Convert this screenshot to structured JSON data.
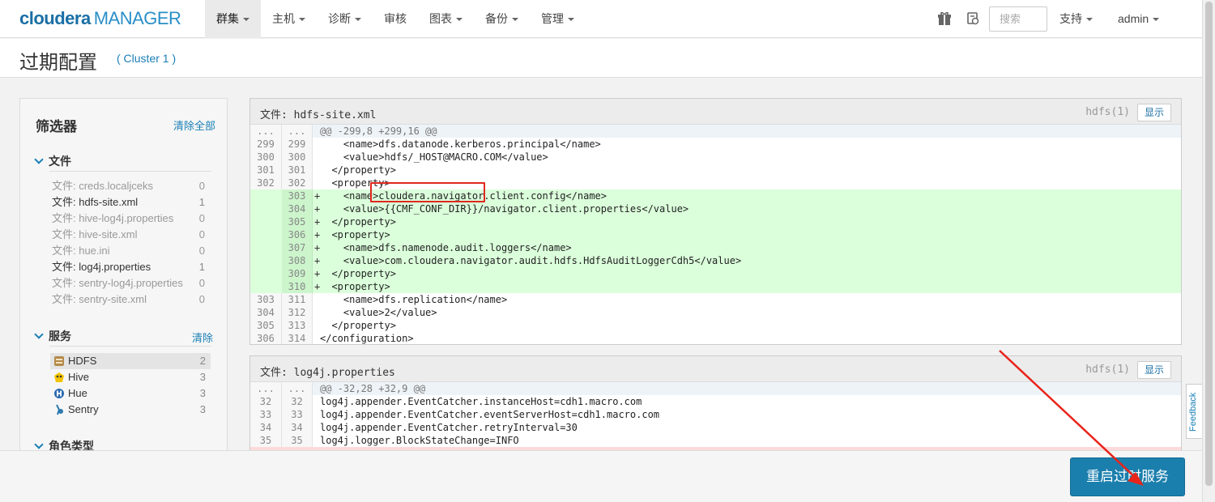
{
  "brand": {
    "name_bold": "cloudera",
    "name_rest": "MANAGER"
  },
  "nav": {
    "items": [
      {
        "label": "群集",
        "caret": true,
        "active": true
      },
      {
        "label": "主机",
        "caret": true
      },
      {
        "label": "诊断",
        "caret": true
      },
      {
        "label": "审核",
        "caret": false
      },
      {
        "label": "图表",
        "caret": true
      },
      {
        "label": "备份",
        "caret": true
      },
      {
        "label": "管理",
        "caret": true
      }
    ],
    "search_placeholder": "搜索",
    "support_label": "支持",
    "user_label": "admin"
  },
  "page": {
    "title": "过期配置",
    "cluster_link": "( Cluster 1 )"
  },
  "filters": {
    "title": "筛选器",
    "clear_all": "清除全部",
    "files_title": "文件",
    "files": [
      {
        "label": "文件: creds.localjceks",
        "count": "0",
        "active": false
      },
      {
        "label": "文件: hdfs-site.xml",
        "count": "1",
        "active": true
      },
      {
        "label": "文件: hive-log4j.properties",
        "count": "0",
        "active": false
      },
      {
        "label": "文件: hive-site.xml",
        "count": "0",
        "active": false
      },
      {
        "label": "文件: hue.ini",
        "count": "0",
        "active": false
      },
      {
        "label": "文件: log4j.properties",
        "count": "1",
        "active": true
      },
      {
        "label": "文件: sentry-log4j.properties",
        "count": "0",
        "active": false
      },
      {
        "label": "文件: sentry-site.xml",
        "count": "0",
        "active": false
      }
    ],
    "services_title": "服务",
    "services_clear": "清除",
    "services": [
      {
        "label": "HDFS",
        "count": "2",
        "icon": "hdfs-icon",
        "selected": true
      },
      {
        "label": "Hive",
        "count": "3",
        "icon": "hive-icon",
        "selected": false
      },
      {
        "label": "Hue",
        "count": "3",
        "icon": "hue-icon",
        "selected": false
      },
      {
        "label": "Sentry",
        "count": "3",
        "icon": "sentry-icon",
        "selected": false
      }
    ],
    "roles_title": "角色类型"
  },
  "panels": [
    {
      "file": "文件: hdfs-site.xml",
      "service": "hdfs(1)",
      "show": "显示",
      "rows": [
        {
          "type": "hunk",
          "n1": "...",
          "n2": "...",
          "mark": "",
          "text": "@@ -299,8 +299,16 @@"
        },
        {
          "type": "ctx",
          "n1": "299",
          "n2": "299",
          "mark": "",
          "text": "    <name>dfs.datanode.kerberos.principal</name>"
        },
        {
          "type": "ctx",
          "n1": "300",
          "n2": "300",
          "mark": "",
          "text": "    <value>hdfs/_HOST@MACRO.COM</value>"
        },
        {
          "type": "ctx",
          "n1": "301",
          "n2": "301",
          "mark": "",
          "text": "  </property>"
        },
        {
          "type": "ctx",
          "n1": "302",
          "n2": "302",
          "mark": "",
          "text": "  <property>"
        },
        {
          "type": "add",
          "n1": "",
          "n2": "303",
          "mark": "+",
          "text": "    <name>cloudera.navigator.client.config</name>"
        },
        {
          "type": "add",
          "n1": "",
          "n2": "304",
          "mark": "+",
          "text": "    <value>{{CMF_CONF_DIR}}/navigator.client.properties</value>"
        },
        {
          "type": "add",
          "n1": "",
          "n2": "305",
          "mark": "+",
          "text": "  </property>"
        },
        {
          "type": "add",
          "n1": "",
          "n2": "306",
          "mark": "+",
          "text": "  <property>"
        },
        {
          "type": "add",
          "n1": "",
          "n2": "307",
          "mark": "+",
          "text": "    <name>dfs.namenode.audit.loggers</name>"
        },
        {
          "type": "add",
          "n1": "",
          "n2": "308",
          "mark": "+",
          "text": "    <value>com.cloudera.navigator.audit.hdfs.HdfsAuditLoggerCdh5</value>"
        },
        {
          "type": "add",
          "n1": "",
          "n2": "309",
          "mark": "+",
          "text": "  </property>"
        },
        {
          "type": "add",
          "n1": "",
          "n2": "310",
          "mark": "+",
          "text": "  <property>"
        },
        {
          "type": "ctx",
          "n1": "303",
          "n2": "311",
          "mark": "",
          "text": "    <name>dfs.replication</name>"
        },
        {
          "type": "ctx",
          "n1": "304",
          "n2": "312",
          "mark": "",
          "text": "    <value>2</value>"
        },
        {
          "type": "ctx",
          "n1": "305",
          "n2": "313",
          "mark": "",
          "text": "  </property>"
        },
        {
          "type": "ctx",
          "n1": "306",
          "n2": "314",
          "mark": "",
          "text": "</configuration>"
        }
      ]
    },
    {
      "file": "文件: log4j.properties",
      "service": "hdfs(1)",
      "show": "显示",
      "rows": [
        {
          "type": "hunk",
          "n1": "...",
          "n2": "...",
          "mark": "",
          "text": "@@ -32,28 +32,9 @@"
        },
        {
          "type": "ctx",
          "n1": "32",
          "n2": "32",
          "mark": "",
          "text": "log4j.appender.EventCatcher.instanceHost=cdh1.macro.com"
        },
        {
          "type": "ctx",
          "n1": "33",
          "n2": "33",
          "mark": "",
          "text": "log4j.appender.EventCatcher.eventServerHost=cdh1.macro.com"
        },
        {
          "type": "ctx",
          "n1": "34",
          "n2": "34",
          "mark": "",
          "text": "log4j.appender.EventCatcher.retryInterval=30"
        },
        {
          "type": "ctx",
          "n1": "35",
          "n2": "35",
          "mark": "",
          "text": "log4j.logger.BlockStateChange=INFO"
        },
        {
          "type": "del",
          "n1": "",
          "n2": "",
          "mark": "",
          "text": ""
        }
      ]
    }
  ],
  "feedback_label": "Feedback",
  "restart_button": "重启过时服务"
}
